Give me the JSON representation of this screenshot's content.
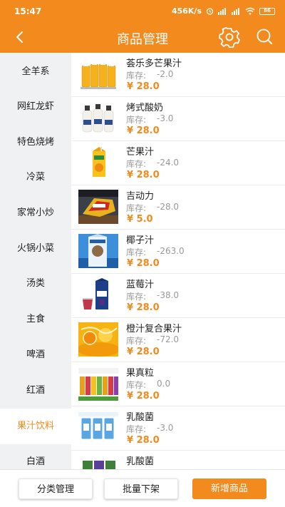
{
  "status_bar": {
    "time": "15:47",
    "net_speed": "456K/s",
    "battery": "86"
  },
  "header": {
    "title": "商品管理"
  },
  "colors": {
    "accent": "#f28a1e",
    "sidebar_bg": "#f0f1f3"
  },
  "icons": {
    "back": "chevron-left-icon",
    "settings": "gear-icon",
    "search": "search-icon"
  },
  "categories": [
    {
      "label": "全羊系",
      "active": false
    },
    {
      "label": "网红龙虾",
      "active": false
    },
    {
      "label": "特色烧烤",
      "active": false
    },
    {
      "label": "冷菜",
      "active": false
    },
    {
      "label": "家常小炒",
      "active": false
    },
    {
      "label": "火锅小菜",
      "active": false
    },
    {
      "label": "汤类",
      "active": false
    },
    {
      "label": "主食",
      "active": false
    },
    {
      "label": "啤酒",
      "active": false
    },
    {
      "label": "红酒",
      "active": false
    },
    {
      "label": "果汁饮料",
      "active": true
    },
    {
      "label": "白酒",
      "active": false
    }
  ],
  "stock_label": "库存:",
  "products": [
    {
      "name": "荟乐多芒果汁",
      "stock": "-2.0",
      "price": "¥ 28.0",
      "image": "bottles-mango"
    },
    {
      "name": "烤式酸奶",
      "stock": "-3.0",
      "price": "¥ 28.0",
      "image": "bottles-yogurt"
    },
    {
      "name": "芒果汁",
      "stock": "-24.0",
      "price": "¥ 28.0",
      "image": "carton-mango"
    },
    {
      "name": "吉动力",
      "stock": "-28.0",
      "price": "¥ 5.0",
      "image": "can-energy"
    },
    {
      "name": "椰子汁",
      "stock": "-263.0",
      "price": "¥ 28.0",
      "image": "carton-coconut"
    },
    {
      "name": "蓝莓汁",
      "stock": "-38.0",
      "price": "¥ 28.0",
      "image": "carton-blueberry"
    },
    {
      "name": "橙汁复合果汁",
      "stock": "-72.0",
      "price": "¥ 28.0",
      "image": "orange-splash"
    },
    {
      "name": "果真粒",
      "stock": "0.0",
      "price": "¥ 28.0",
      "image": "bottle-lineup"
    },
    {
      "name": "乳酸菌",
      "stock": "-3.0",
      "price": "¥ 28.0",
      "image": "lactic-pack"
    },
    {
      "name": "乳酸菌",
      "stock": "",
      "price": "",
      "image": "lactic-pack-2"
    }
  ],
  "footer": {
    "category_manage": "分类管理",
    "batch_offline": "批量下架",
    "add_product": "新增商品"
  }
}
